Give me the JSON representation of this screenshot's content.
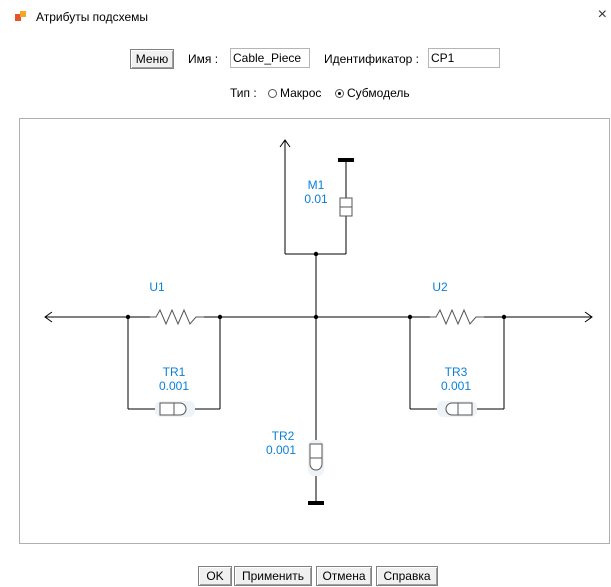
{
  "window": {
    "title": "Атрибуты подсхемы",
    "close_glyph": "×"
  },
  "header": {
    "menu_label": "Меню",
    "name_label": "Имя :",
    "name_value": "Cable_Piece",
    "id_label": "Идентификатор :",
    "id_value": "CP1",
    "type_label": "Тип :",
    "type_options": [
      "Макрос",
      "Субмодель"
    ],
    "type_selected": "Субмодель"
  },
  "schematic": {
    "components": {
      "m1": {
        "name": "M1",
        "value": "0.01"
      },
      "u1": {
        "name": "U1"
      },
      "u2": {
        "name": "U2"
      },
      "tr1": {
        "name": "TR1",
        "value": "0.001"
      },
      "tr2": {
        "name": "TR2",
        "value": "0.001"
      },
      "tr3": {
        "name": "TR3",
        "value": "0.001"
      }
    },
    "colors": {
      "label": "#0a7fd8",
      "wire": "#000000",
      "symbol": "#555555",
      "canvas": "#ffffff"
    }
  },
  "footer": {
    "ok_label": "OK",
    "apply_label": "Применить",
    "cancel_label": "Отмена",
    "help_label": "Справка"
  }
}
